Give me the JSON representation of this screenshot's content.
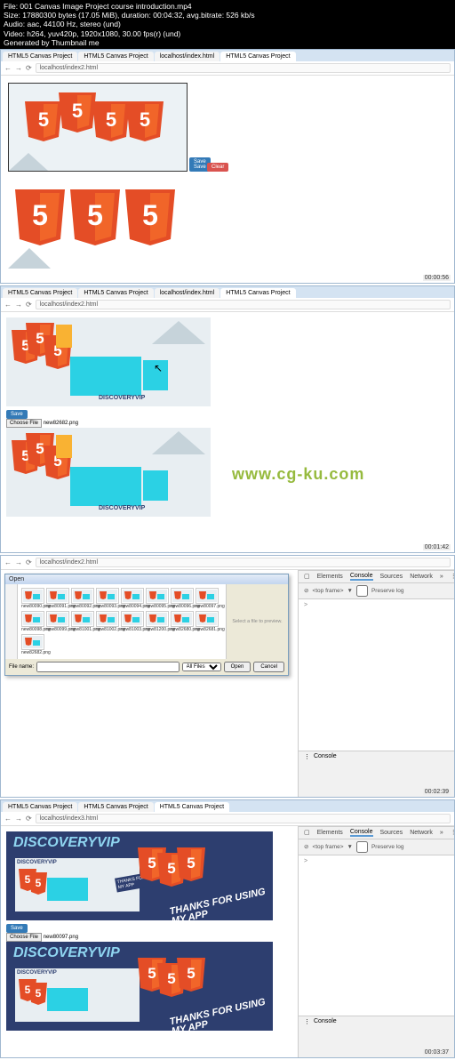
{
  "meta": {
    "file": "File: 001 Canvas Image Project course introduction.mp4",
    "size": "Size: 17880300 bytes (17.05 MiB), duration: 00:04:32, avg.bitrate: 526 kb/s",
    "audio": "Audio: aac, 44100 Hz, stereo (und)",
    "video": "Video: h264, yuv420p, 1920x1080, 30.00 fps(r) (und)",
    "gen": "Generated by Thumbnail me"
  },
  "browser": {
    "tabs": [
      "HTML5 Canvas Project",
      "HTML5 Canvas Project",
      "localhost/index.html",
      "HTML5 Canvas Project"
    ],
    "url": "localhost/index2.html",
    "url3": "localhost/index3.html"
  },
  "controls": {
    "save": "Save",
    "clear": "Clear",
    "choose": "Choose File",
    "filename": "new82682.png",
    "filename2": "new80097.png"
  },
  "watermark": "www.cg-ku.com",
  "timestamps": {
    "t1": "00:00:56",
    "t2": "00:01:42",
    "t3": "00:02:39",
    "t4": "00:03:37"
  },
  "devtools": {
    "tabs": [
      "Elements",
      "Console",
      "Sources",
      "Network"
    ],
    "more": "»",
    "topframe": "<top frame>",
    "preserve": "Preserve log",
    "drawer": "Console",
    "prompt": ">"
  },
  "filedialog": {
    "title": "Open",
    "thumbs": [
      "new80090.png",
      "new80091.png",
      "new80092.png",
      "new80093.png",
      "new80094.png",
      "new80095.png",
      "new80096.png",
      "new80097.png",
      "new80098.png",
      "new80099.png",
      "new81001.png",
      "new81002.png",
      "new81003.png",
      "new81200.png",
      "new82680.png",
      "new82681.png",
      "new82682.png"
    ],
    "preview": "Select a file to preview.",
    "filename_label": "File name:",
    "filetype": "All Files",
    "open": "Open",
    "cancel": "Cancel"
  },
  "discovery": {
    "title": "DISCOVERYVIP",
    "sub": "DISCOVERYVIP",
    "thanks1": "THANKS FOR USING",
    "thanks2": "MY APP"
  }
}
